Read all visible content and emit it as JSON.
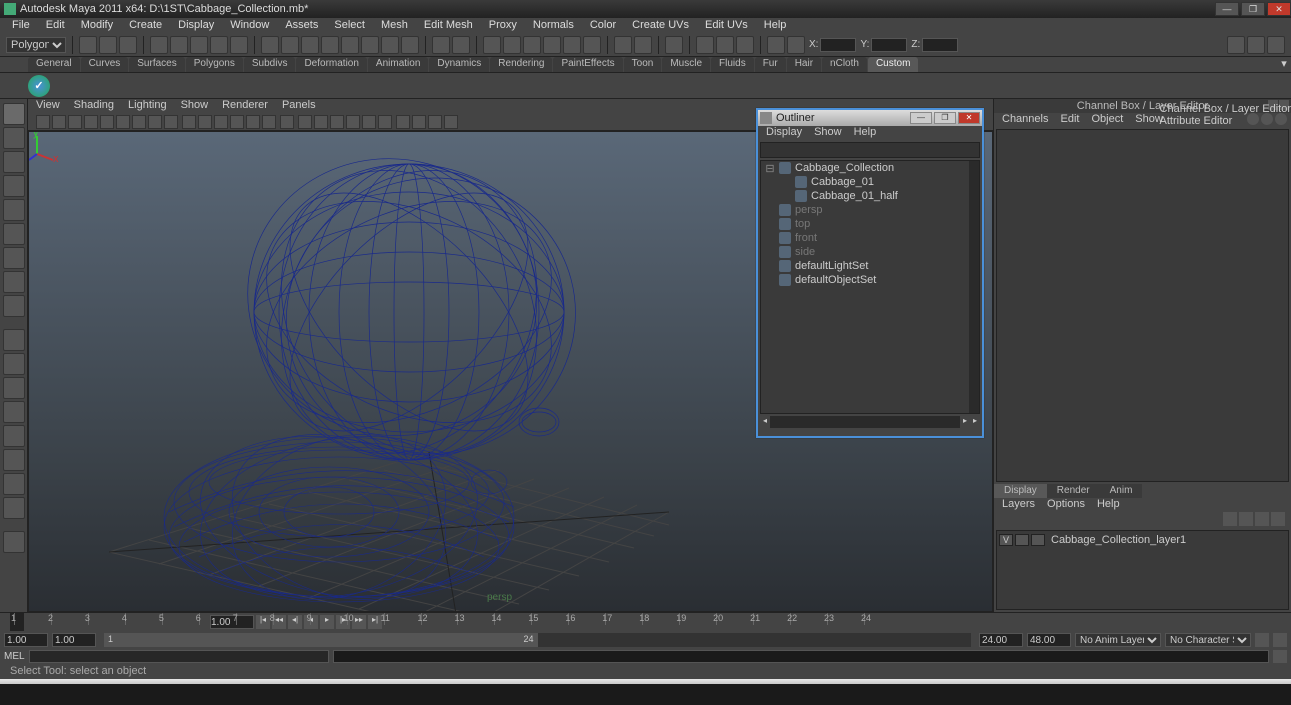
{
  "window": {
    "title": "Autodesk Maya 2011 x64: D:\\1ST\\Cabbage_Collection.mb*"
  },
  "menubar": [
    "File",
    "Edit",
    "Modify",
    "Create",
    "Display",
    "Window",
    "Assets",
    "Select",
    "Mesh",
    "Edit Mesh",
    "Proxy",
    "Normals",
    "Color",
    "Create UVs",
    "Edit UVs",
    "Help"
  ],
  "modeSelector": "Polygons",
  "coords": {
    "x_label": "X:",
    "y_label": "Y:",
    "z_label": "Z:",
    "x": "",
    "y": "",
    "z": ""
  },
  "shelfTabs": [
    "General",
    "Curves",
    "Surfaces",
    "Polygons",
    "Subdivs",
    "Deformation",
    "Animation",
    "Dynamics",
    "Rendering",
    "PaintEffects",
    "Toon",
    "Muscle",
    "Fluids",
    "Fur",
    "Hair",
    "nCloth",
    "Custom"
  ],
  "shelfActiveTab": "Custom",
  "viewportMenu": [
    "View",
    "Shading",
    "Lighting",
    "Show",
    "Renderer",
    "Panels"
  ],
  "cameraLabel": "persp",
  "outliner": {
    "title": "Outliner",
    "menu": [
      "Display",
      "Show",
      "Help"
    ],
    "items": [
      {
        "label": "Cabbage_Collection",
        "type": "group",
        "expand": "-"
      },
      {
        "label": "Cabbage_01",
        "type": "mesh",
        "child": true
      },
      {
        "label": "Cabbage_01_half",
        "type": "mesh",
        "child": true
      },
      {
        "label": "persp",
        "type": "camera",
        "dim": true
      },
      {
        "label": "top",
        "type": "camera",
        "dim": true
      },
      {
        "label": "front",
        "type": "camera",
        "dim": true
      },
      {
        "label": "side",
        "type": "camera",
        "dim": true
      },
      {
        "label": "defaultLightSet",
        "type": "set"
      },
      {
        "label": "defaultObjectSet",
        "type": "set"
      }
    ]
  },
  "channelBox": {
    "title": "Channel Box / Layer Editor",
    "menu": [
      "Channels",
      "Edit",
      "Object",
      "Show"
    ],
    "sideTabs": [
      "Channel Box / Layer Editor",
      "Attribute Editor"
    ],
    "displayTabs": [
      "Display",
      "Render",
      "Anim"
    ],
    "displayActive": "Display",
    "layerMenu": [
      "Layers",
      "Options",
      "Help"
    ],
    "layers": [
      {
        "v": "V",
        "c": "",
        "name": "Cabbage_Collection_layer1"
      }
    ]
  },
  "timeline": {
    "start": "1.00",
    "innerStart": "1.00",
    "rangeStart": "1",
    "rangeEnd": "24",
    "innerEnd": "24.00",
    "end": "48.00",
    "currentInput": "1.00",
    "ticks": [
      1,
      2,
      3,
      4,
      5,
      6,
      7,
      8,
      9,
      10,
      11,
      12,
      13,
      14,
      15,
      16,
      17,
      18,
      19,
      20,
      21,
      22,
      23,
      24
    ],
    "animLayer": "No Anim Layer",
    "charSet": "No Character Set"
  },
  "cmd": {
    "lang": "MEL"
  },
  "help": "Select Tool: select an object"
}
